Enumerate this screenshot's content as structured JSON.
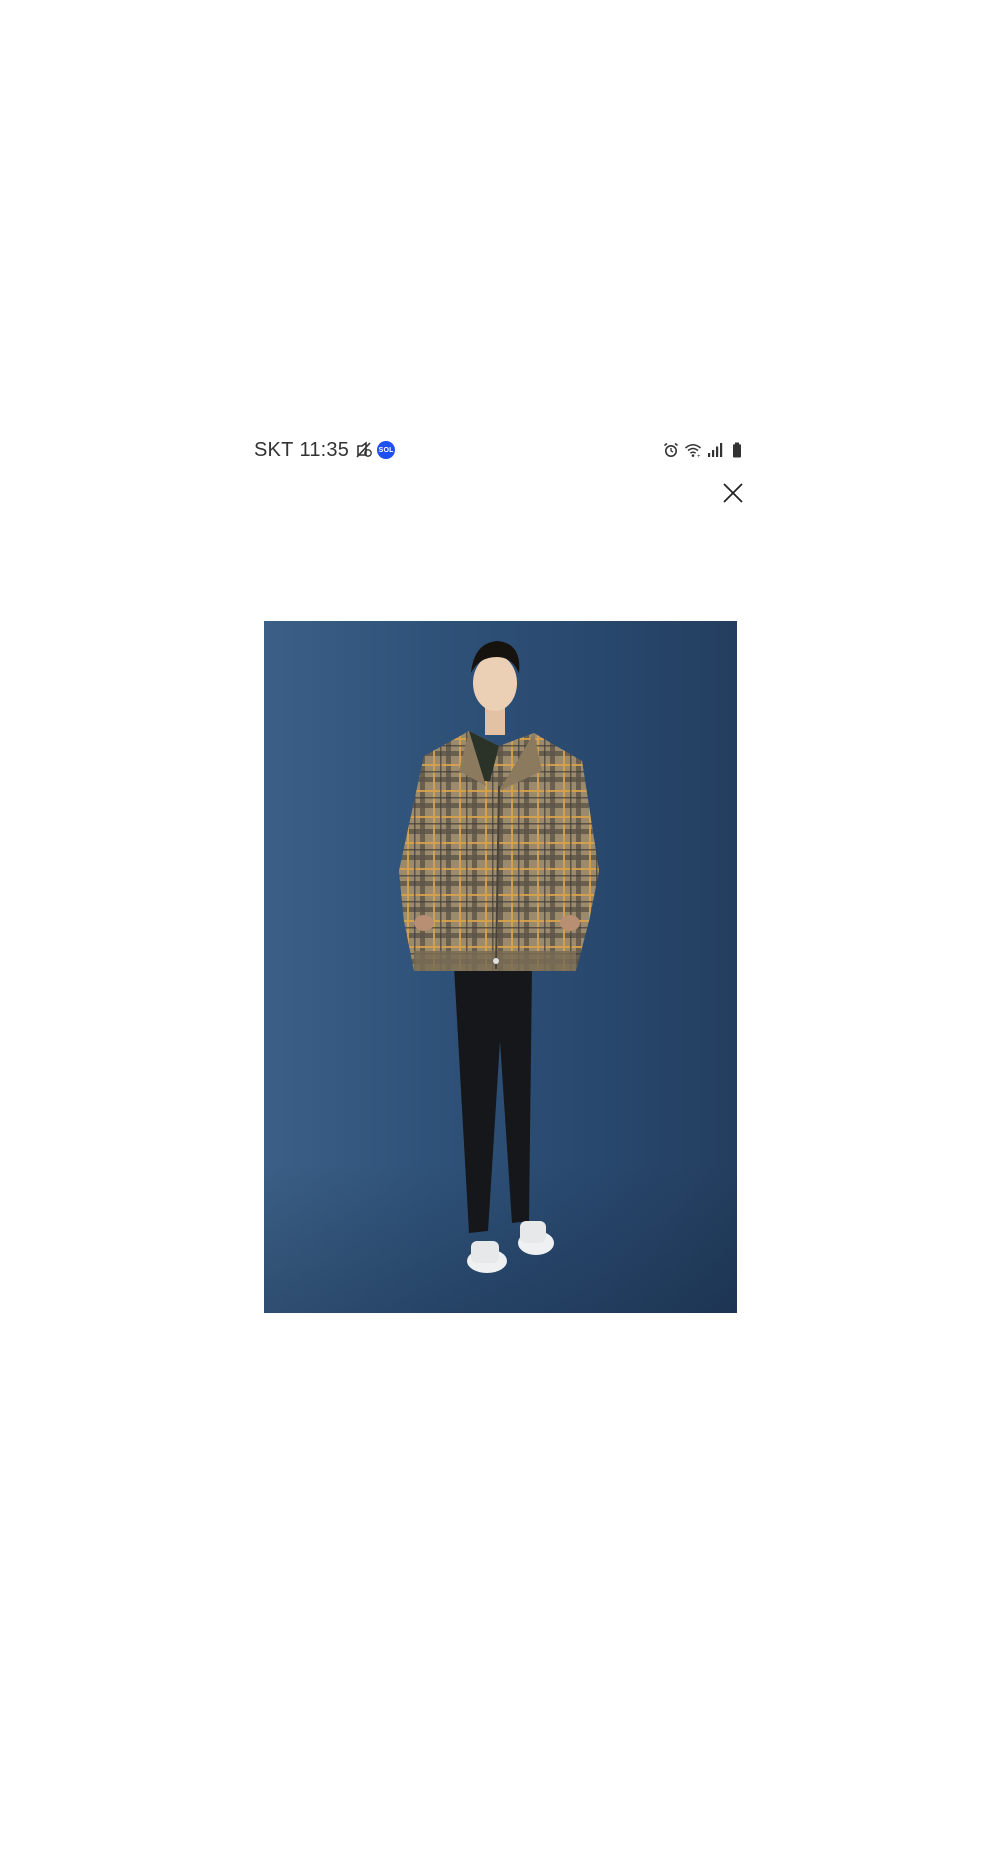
{
  "status_bar": {
    "carrier": "SKT",
    "time": "11:35",
    "left_icons": [
      "silent-notification-icon",
      "app-badge-icon"
    ],
    "app_badge_text": "SOL",
    "app_badge_color": "#1d4ff1",
    "right_icons": [
      "alarm-icon",
      "wifi-icon",
      "signal-icon",
      "battery-icon"
    ]
  },
  "overlay": {
    "close_icon": "close-icon"
  },
  "image": {
    "subject": "product-photo",
    "background_color": "#2f5279"
  }
}
